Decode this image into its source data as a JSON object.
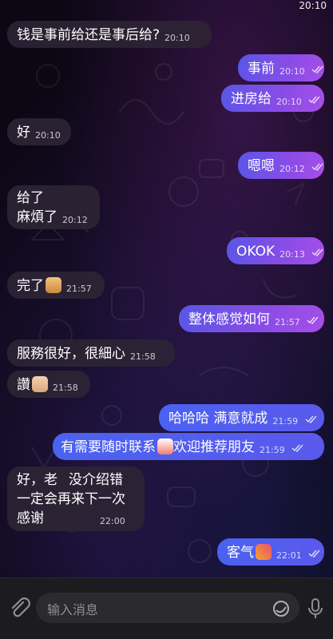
{
  "status": {
    "time": "20:10"
  },
  "messages": [
    {
      "text": "钱是事前给还是事后给?",
      "time": "20:10"
    },
    {
      "text": "事前",
      "time": "20:10"
    },
    {
      "text": "进房给",
      "time": "20:10"
    },
    {
      "text": "好",
      "time": "20:10"
    },
    {
      "text": "嗯嗯",
      "time": "20:12"
    },
    {
      "lines": [
        "给了",
        "麻煩了"
      ],
      "time": "20:12"
    },
    {
      "text": "OKOK",
      "time": "20:13"
    },
    {
      "text": "完了",
      "emoji": "pray-emoji",
      "time": "21:57"
    },
    {
      "text": "整体感觉如何",
      "time": "21:57"
    },
    {
      "text": "服務很好，很細心",
      "time": "21:58"
    },
    {
      "text": "讚",
      "emoji": "thumbs-up-emoji",
      "time": "21:58"
    },
    {
      "text": "哈哈哈 满意就成",
      "time": "21:59"
    },
    {
      "text_before": "有需要随时联系",
      "emoji": "emoji-face",
      "text_after": "欢迎推荐朋友",
      "time": "21:59"
    },
    {
      "lines": [
        "好，老",
        "没介绍错",
        "一定会再来下一次",
        "感谢"
      ],
      "time": "22:00"
    },
    {
      "text": "客气",
      "emoji": "party-emoji",
      "time": "22:01"
    }
  ],
  "composer": {
    "placeholder": "输入消息",
    "icons": [
      "paperclip-icon",
      "sticker-icon",
      "microphone-icon"
    ]
  },
  "colors": {
    "incoming_bubble": "#2c2434",
    "outgoing_bubble_start": "#5a56e6",
    "outgoing_bubble_end": "#a54fe8",
    "background": "#0b0713"
  }
}
